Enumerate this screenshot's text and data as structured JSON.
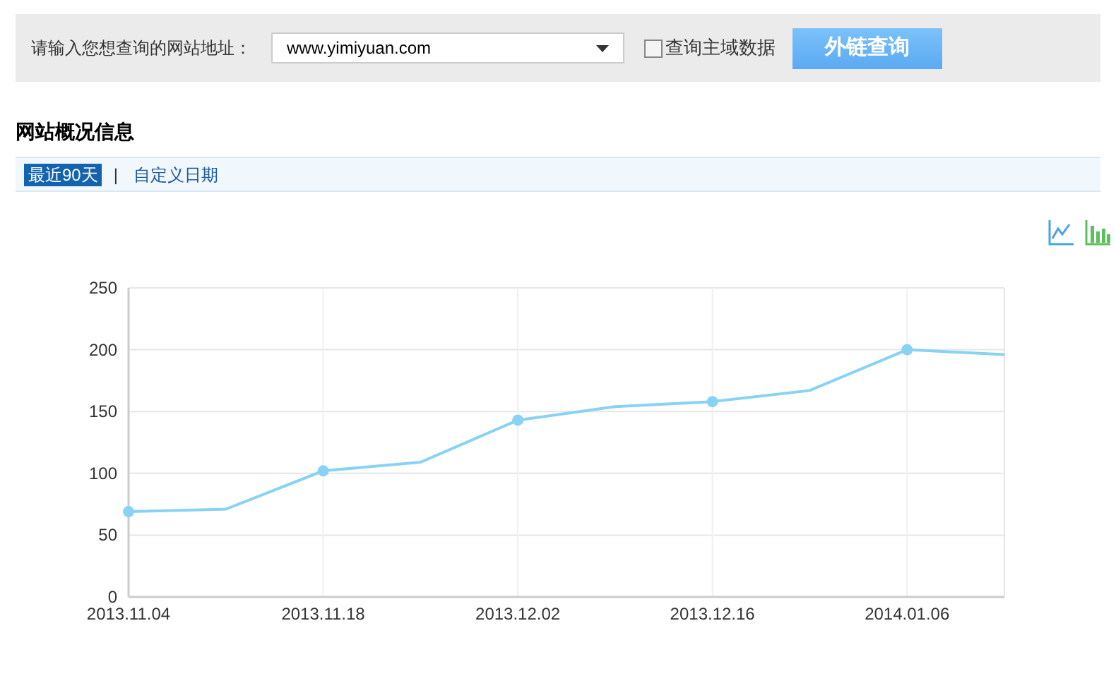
{
  "query_bar": {
    "label": "请输入您想查询的网站地址：",
    "site_select": {
      "value": "www.yimiyuan.com"
    },
    "main_domain_checkbox": {
      "label": "查询主域数据",
      "checked": false
    },
    "search_button": "外链查询"
  },
  "section": {
    "title": "网站概况信息",
    "tabs": [
      {
        "label": "最近90天",
        "selected": true
      },
      {
        "label": "自定义日期",
        "selected": false
      }
    ],
    "tab_separator": "|"
  },
  "chart_view_buttons": [
    {
      "kind": "line",
      "selected": true
    },
    {
      "kind": "bar",
      "selected": false
    }
  ],
  "chart_data": {
    "type": "line",
    "categories": [
      "2013.11.04",
      null,
      "2013.11.18",
      null,
      "2013.12.02",
      null,
      "2013.12.16",
      null,
      "2014.01.06",
      null
    ],
    "series": [
      {
        "color": "#87d2f5",
        "values": [
          69,
          71,
          102,
          109,
          143,
          154,
          158,
          167,
          200,
          196
        ]
      }
    ],
    "ylim": [
      0,
      250
    ],
    "grid": true,
    "yticks": [
      0,
      50,
      100,
      150,
      200,
      250
    ]
  }
}
